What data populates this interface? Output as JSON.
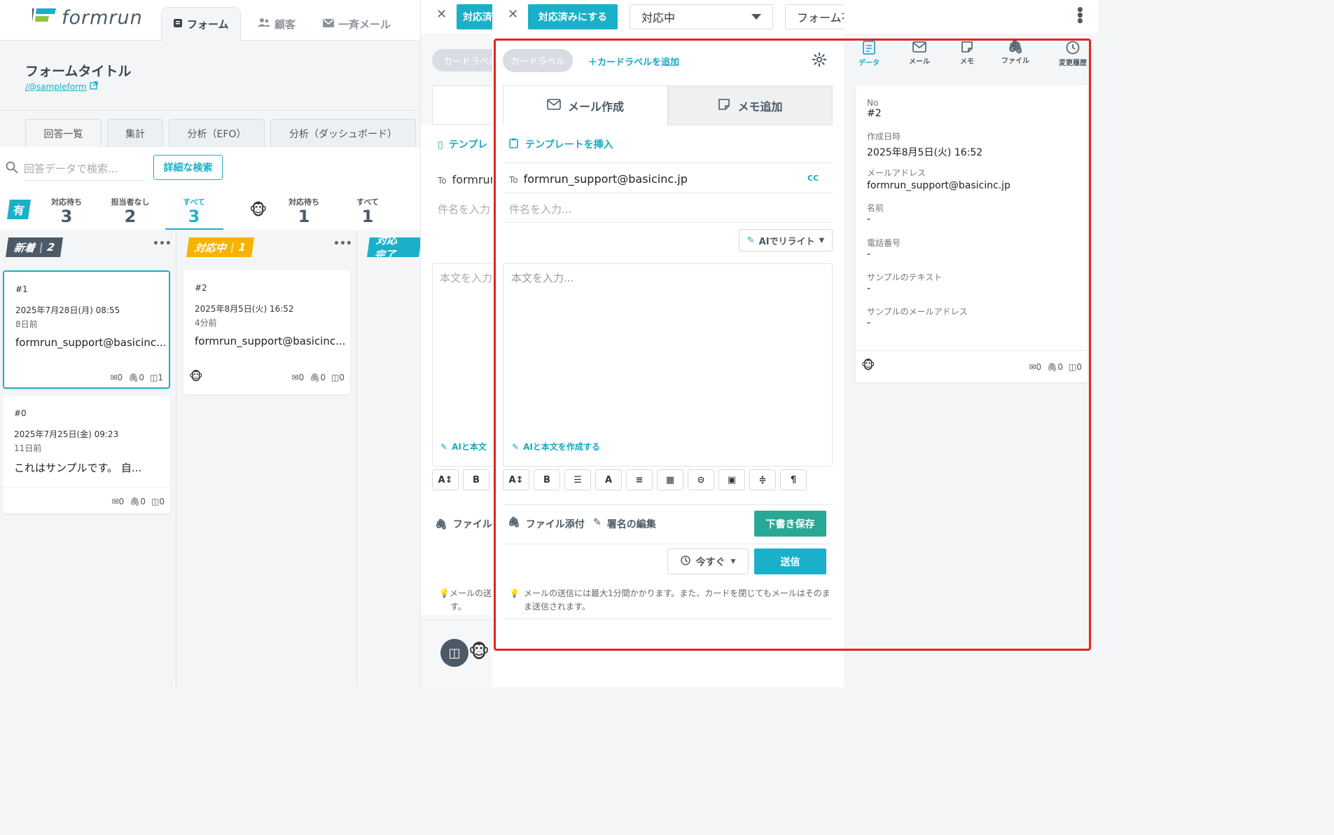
{
  "app": {
    "logo_text": "formrun",
    "nav": {
      "form": "フォーム",
      "customers": "顧客",
      "bulk_mail": "一斉メール"
    }
  },
  "form": {
    "title": "フォームタイトル",
    "link": "/@sampleform"
  },
  "subtabs": [
    "回答一覧",
    "集計",
    "分析（EFO）",
    "分析（ダッシュボード）"
  ],
  "search": {
    "placeholder": "回答データで検索...",
    "advanced": "詳細な検索"
  },
  "stats": {
    "owner_badge": "有",
    "waiting_label": "対応待ち",
    "waiting": "3",
    "unassigned_label": "担当者なし",
    "unassigned": "2",
    "all_label": "すべて",
    "all": "3",
    "user_waiting_label": "対応待ち",
    "user_waiting": "1",
    "user_all_label": "すべて",
    "user_all": "1"
  },
  "columns": [
    {
      "name": "新着",
      "count": "2",
      "color": "#4b5a66"
    },
    {
      "name": "対応中",
      "count": "1",
      "color": "#f6b400"
    },
    {
      "name": "対応完了",
      "color": "#1ab0c9"
    }
  ],
  "cards": [
    {
      "no": "#1",
      "date": "2025年7月28日(月) 08:55",
      "ago": "8日前",
      "text": "formrun_support@basicinc...",
      "mail": "0",
      "file": "0",
      "memo": "1"
    },
    {
      "no": "#0",
      "date": "2025年7月25日(金) 09:23",
      "ago": "11日前",
      "text": "これはサンプルです。 自...",
      "mail": "0",
      "file": "0",
      "memo": "0"
    },
    {
      "no": "#2",
      "date": "2025年8月5日(火) 16:52",
      "ago": "4分前",
      "text": "formrun_support@basicinc...",
      "mail": "0",
      "file": "0",
      "memo": "0"
    }
  ],
  "middle": {
    "done_btn": "対応済",
    "card_label": "カードラベル",
    "template": "テンプレ",
    "to_label": "To",
    "to_value": "formrun",
    "subject": "件名を入力",
    "body": "本文を入力",
    "ai": "AIと本文",
    "attach": "ファイル",
    "note1": "メールの送",
    "note2": "す。"
  },
  "panel": {
    "done_btn": "対応済みにする",
    "status": "対応中",
    "assignee": "フォーム花子",
    "card_label": "カードラベル",
    "add_label": "＋カードラベルを追加",
    "tab_mail": "メール作成",
    "tab_memo": "メモ追加",
    "insert_template": "テンプレートを挿入",
    "to_label": "To",
    "to_value": "formrun_support@basicinc.jp",
    "cc": "CC",
    "subject_placeholder": "件名を入力...",
    "ai_rewrite": "AIでリライト",
    "body_placeholder": "本文を入力...",
    "ai_compose": "AIと本文を作成する",
    "toolbar": [
      "A↕",
      "B",
      "☰",
      "A",
      "≡",
      "▦",
      "⊝",
      "▣",
      "≑",
      "¶"
    ],
    "attach": "ファイル添付",
    "signature": "署名の編集",
    "save_draft": "下書き保存",
    "schedule": "今すぐ",
    "send": "送信",
    "note": "メールの送信には最大1分間かかります。また、カードを閉じてもメールはそのまま送信されます。"
  },
  "side": {
    "nav": {
      "data": "データ",
      "mail": "メール",
      "memo": "メモ",
      "file": "ファイル",
      "history": "変更履歴"
    },
    "fields": [
      {
        "label": "No",
        "value": "#2"
      },
      {
        "label": "作成日時",
        "value": "2025年8月5日(火) 16:52"
      },
      {
        "label": "メールアドレス",
        "value": "formrun_support@basicinc.jp"
      },
      {
        "label": "名前",
        "value": "-"
      },
      {
        "label": "電話番号",
        "value": "-"
      },
      {
        "label": "サンプルのテキスト",
        "value": "-"
      },
      {
        "label": "サンプルのメールアドレス",
        "value": "-"
      }
    ],
    "counts": {
      "mail": "0",
      "file": "0",
      "memo": "0"
    }
  },
  "colors": {
    "accent": "#1ab0c9",
    "green": "#2aa896",
    "highlight": "#e3241d"
  }
}
